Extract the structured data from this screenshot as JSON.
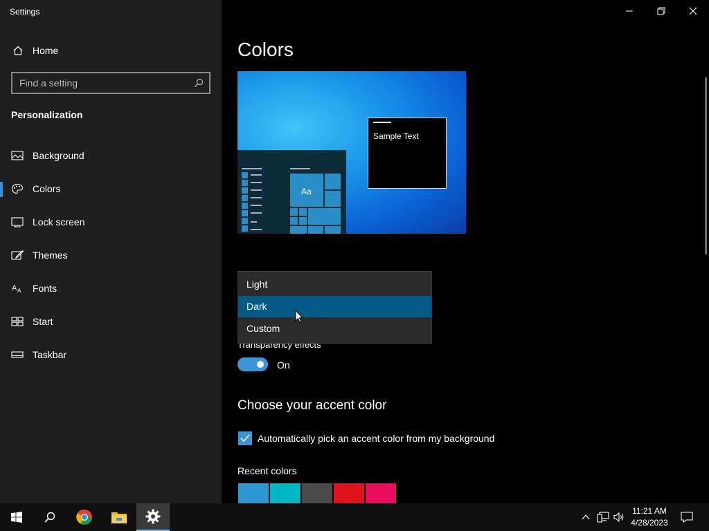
{
  "window": {
    "title": "Settings"
  },
  "sidebar": {
    "home_label": "Home",
    "search_placeholder": "Find a setting",
    "section_title": "Personalization",
    "items": [
      {
        "label": "Background",
        "icon": "picture-icon",
        "selected": false
      },
      {
        "label": "Colors",
        "icon": "palette-icon",
        "selected": true
      },
      {
        "label": "Lock screen",
        "icon": "lock-screen-icon",
        "selected": false
      },
      {
        "label": "Themes",
        "icon": "brush-icon",
        "selected": false
      },
      {
        "label": "Fonts",
        "icon": "font-icon",
        "selected": false
      },
      {
        "label": "Start",
        "icon": "start-tiles-icon",
        "selected": false
      },
      {
        "label": "Taskbar",
        "icon": "taskbar-icon",
        "selected": false
      }
    ]
  },
  "main": {
    "title": "Colors",
    "preview": {
      "sample_text": "Sample Text",
      "tile_text": "Aa"
    },
    "color_mode_dropdown": {
      "options": [
        "Light",
        "Dark",
        "Custom"
      ],
      "selected": "Dark"
    },
    "transparency": {
      "label": "Transparency effects",
      "state_label": "On",
      "enabled": true
    },
    "accent": {
      "title": "Choose your accent color",
      "auto_pick_label": "Automatically pick an accent color from my background",
      "auto_pick_checked": true,
      "recent_title": "Recent colors",
      "recent_colors": [
        "#2f96d4",
        "#00b6c1",
        "#4a4a4a",
        "#e0121b",
        "#ea0a5e"
      ]
    }
  },
  "taskbar": {
    "time": "11:21 AM",
    "date": "4/28/2023",
    "pinned": [
      "start-icon",
      "search-icon",
      "chrome-icon",
      "file-explorer-icon",
      "settings-icon"
    ]
  },
  "colors": {
    "accent": "#3a96d6",
    "selection": "#005a84",
    "sidebar_bg": "#1f1f1f"
  }
}
